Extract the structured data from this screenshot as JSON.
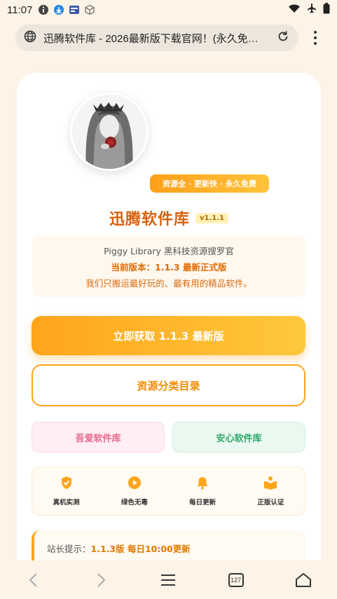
{
  "status_bar": {
    "time": "11:07"
  },
  "browser": {
    "url_text": "迅腾软件库 - 2026最新版下载官网！(永久免…",
    "tabs_count": "127"
  },
  "hero": {
    "tags_badge": "资源全 · 更新快 · 永久免费",
    "title": "迅腾软件库",
    "version": "v1.1.1"
  },
  "info": {
    "line1": "Piggy Library 黑科技资源搜罗官",
    "line2": "当前版本：1.1.3 最新正式版",
    "line3": "我们只搬运最好玩的、最有用的精品软件。"
  },
  "buttons": {
    "primary": "立即获取 1.1.3 最新版",
    "catalog": "资源分类目录",
    "pink": "吾爱软件库",
    "green": "安心软件库"
  },
  "features": [
    {
      "label": "真机实测",
      "icon": "shield-check-icon"
    },
    {
      "label": "绿色无毒",
      "icon": "play-circle-icon"
    },
    {
      "label": "每日更新",
      "icon": "bell-icon"
    },
    {
      "label": "正版认证",
      "icon": "book-reader-icon"
    }
  ],
  "notice": {
    "prefix": "站长提示：",
    "highlight": "1.1.3版 每日10:00更新"
  },
  "colors": {
    "accent": "#ffa51c",
    "title": "#d95f0b",
    "background": "#fdf3e6"
  }
}
